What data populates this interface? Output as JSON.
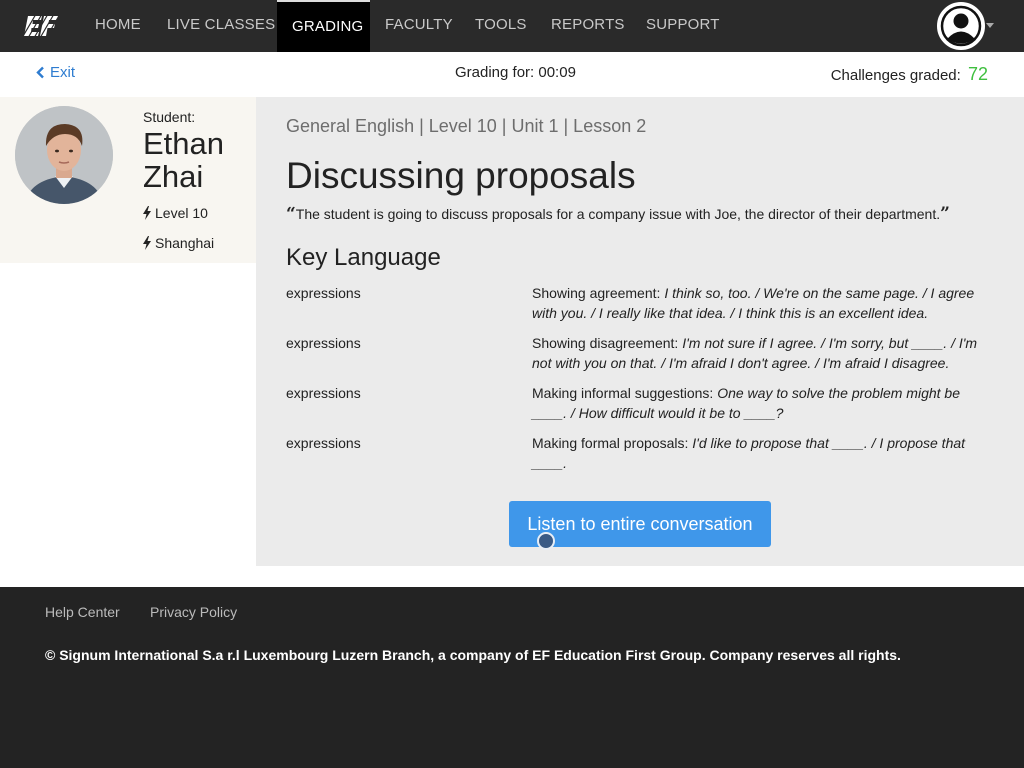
{
  "nav": {
    "logo_text": "EF",
    "items": [
      {
        "label": "HOME"
      },
      {
        "label": "LIVE CLASSES"
      },
      {
        "label": "GRADING"
      },
      {
        "label": "FACULTY"
      },
      {
        "label": "TOOLS"
      },
      {
        "label": "REPORTS"
      },
      {
        "label": "SUPPORT"
      }
    ],
    "active_item": "GRADING",
    "user_icon": "user-avatar-icon"
  },
  "subheader": {
    "exit_label": "Exit",
    "grading_for": "Grading for: 00:09",
    "challenges_label": "Challenges graded:",
    "challenges_count": "72"
  },
  "student": {
    "label": "Student:",
    "first_name": "Ethan",
    "last_name": "Zhai",
    "level": "Level 10",
    "location": "Shanghai"
  },
  "lesson": {
    "course_path": "General English | Level 10 | Unit 1 | Lesson 2",
    "title": "Discussing proposals",
    "description": "The student is going to discuss proposals for a company issue with Joe, the director of their department.",
    "key_language_heading": "Key Language",
    "key_language": [
      {
        "type": "expressions",
        "label": "Showing agreement:",
        "examples": "I think so, too. / We're on the same page. / I agree with you. / I really like that idea. / I think this is an excellent idea."
      },
      {
        "type": "expressions",
        "label": "Showing disagreement:",
        "examples": "I'm not sure if I agree. / I'm sorry, but ____. / I'm not with you on that. / I'm afraid I don't agree. / I'm afraid I disagree."
      },
      {
        "type": "expressions",
        "label": "Making informal suggestions:",
        "examples": "One way to solve the problem might be ____. / How difficult would it be to ____?"
      },
      {
        "type": "expressions",
        "label": "Making formal proposals:",
        "examples": "I'd like to propose that ____. / I propose that ____."
      }
    ],
    "listen_button": "Listen to entire conversation"
  },
  "footer": {
    "links": [
      "Help Center",
      "Privacy Policy"
    ],
    "copyright": "© Signum International S.a r.l Luxembourg Luzern Branch, a company of EF Education First Group. Company reserves all rights."
  },
  "colors": {
    "accent": "#3f97ea",
    "link": "#2e7cd0",
    "count_green": "#3fbf3f",
    "nav_bg": "#2a2a2a"
  }
}
